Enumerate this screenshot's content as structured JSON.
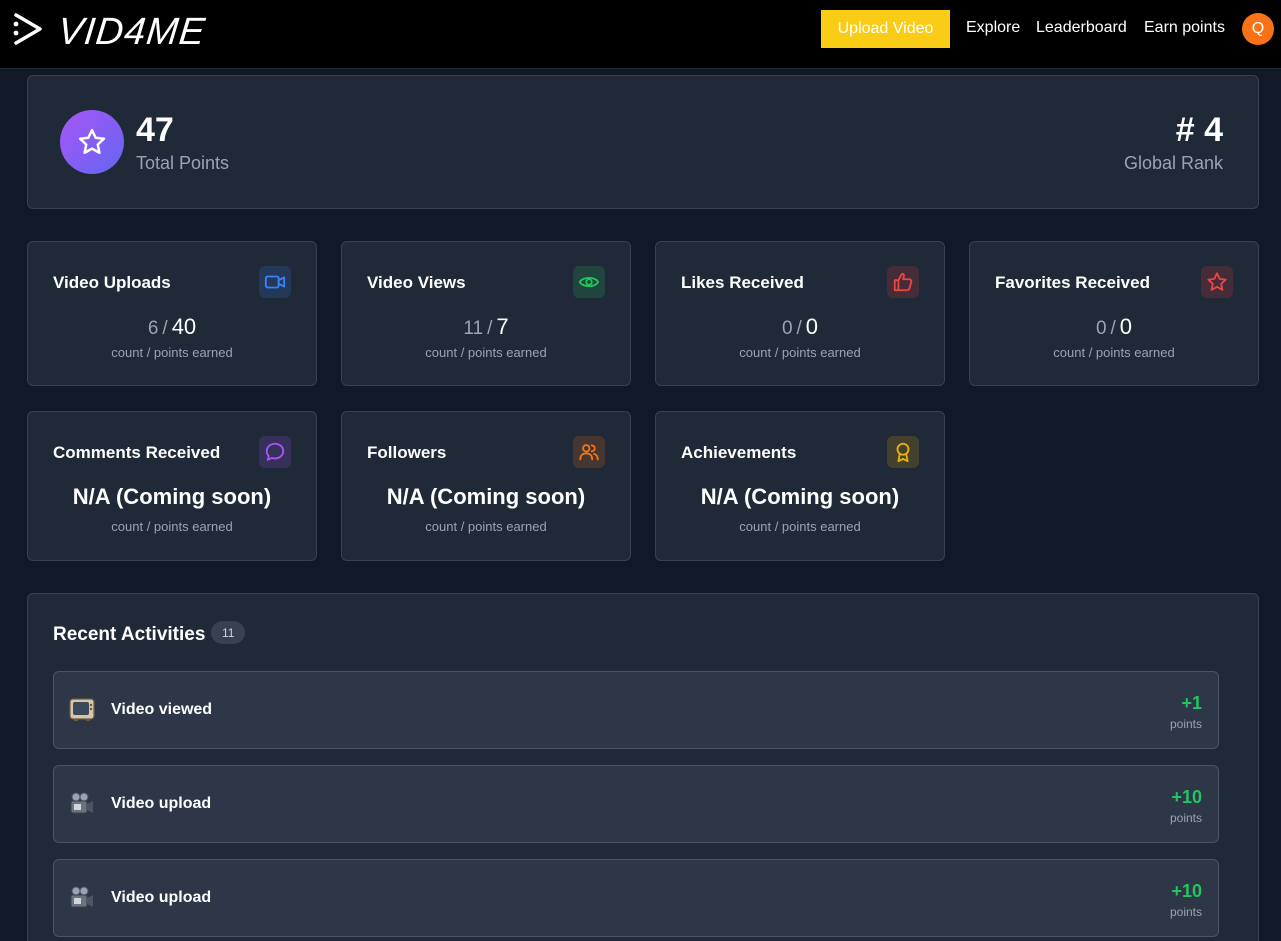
{
  "header": {
    "logo_text": "VID4ME",
    "upload_label": "Upload Video",
    "nav": [
      "Explore",
      "Leaderboard",
      "Earn points"
    ],
    "avatar_initial": "Q"
  },
  "summary": {
    "total_points": "47",
    "total_label": "Total Points",
    "rank": "# 4",
    "rank_label": "Global Rank"
  },
  "stats": [
    {
      "title": "Video Uploads",
      "count": "6",
      "points": "40",
      "sub": "count / points earned",
      "icon": "video-camera-icon",
      "color": "#3b82f6"
    },
    {
      "title": "Video Views",
      "count": "11",
      "points": "7",
      "sub": "count / points earned",
      "icon": "eye-icon",
      "color": "#22c55e"
    },
    {
      "title": "Likes Received",
      "count": "0",
      "points": "0",
      "sub": "count / points earned",
      "icon": "thumbs-up-icon",
      "color": "#ef4444"
    },
    {
      "title": "Favorites Received",
      "count": "0",
      "points": "0",
      "sub": "count / points earned",
      "icon": "star-icon",
      "color": "#ef4444"
    },
    {
      "title": "Comments Received",
      "na": "N/A (Coming soon)",
      "sub": "count / points earned",
      "icon": "chat-bubble-icon",
      "color": "#a855f7"
    },
    {
      "title": "Followers",
      "na": "N/A (Coming soon)",
      "sub": "count / points earned",
      "icon": "users-icon",
      "color": "#f97316"
    },
    {
      "title": "Achievements",
      "na": "N/A (Coming soon)",
      "sub": "count / points earned",
      "icon": "award-ribbon-icon",
      "color": "#eab308"
    }
  ],
  "sep": "/",
  "activities": {
    "title": "Recent Activities",
    "count": "11",
    "items": [
      {
        "label": "Video viewed",
        "points": "+1",
        "unit": "points",
        "icon": "television-icon"
      },
      {
        "label": "Video upload",
        "points": "+10",
        "unit": "points",
        "icon": "movie-camera-icon"
      },
      {
        "label": "Video upload",
        "points": "+10",
        "unit": "points",
        "icon": "movie-camera-icon"
      }
    ]
  }
}
